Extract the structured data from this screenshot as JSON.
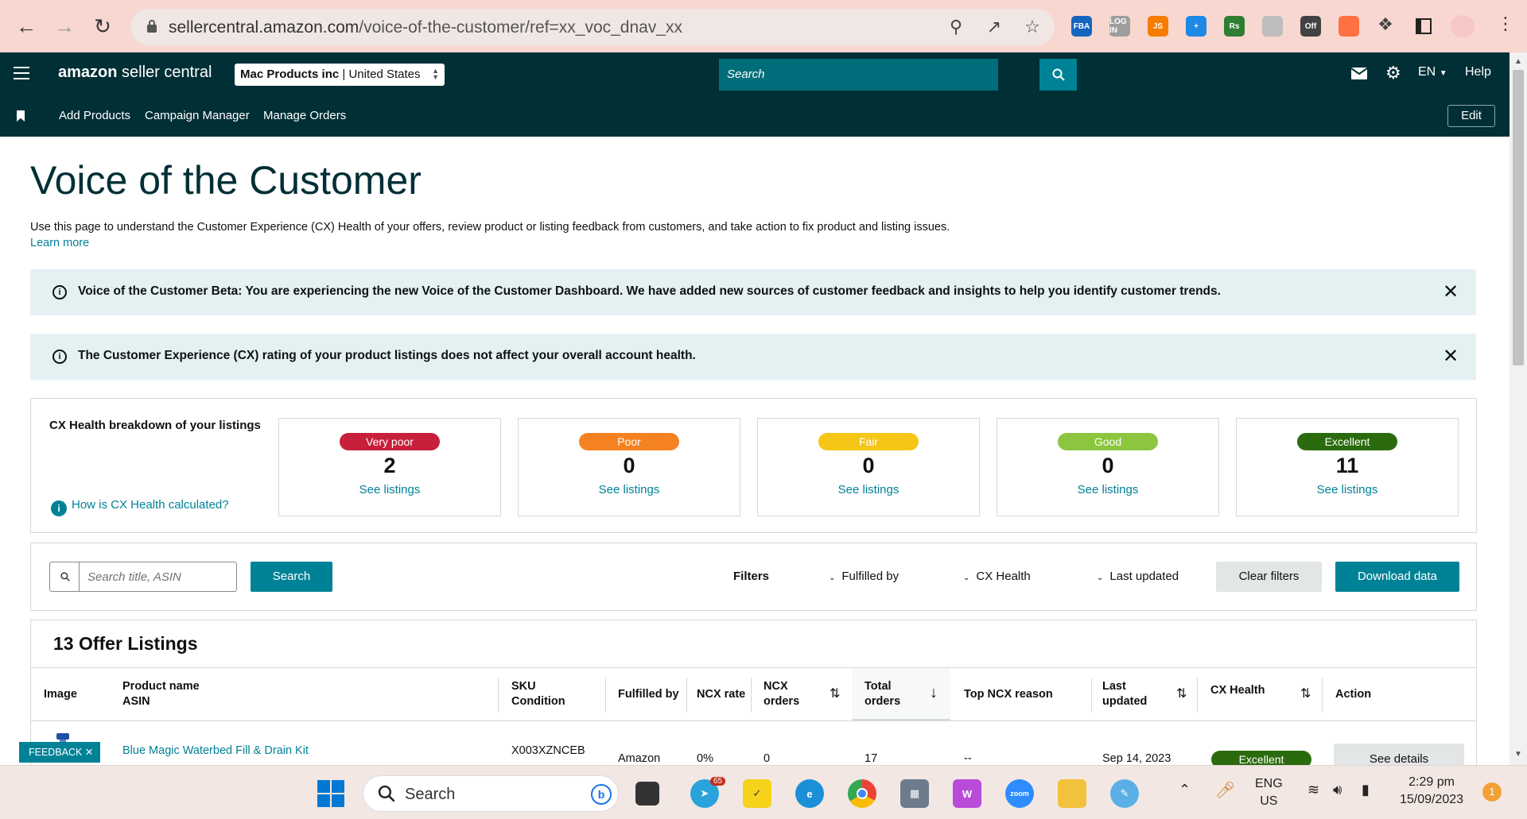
{
  "browser": {
    "url_host": "sellercentral.amazon.com",
    "url_path": "/voice-of-the-customer/ref=xx_voc_dnav_xx",
    "extensions": [
      {
        "name": "fba-extension-icon",
        "label": "FBA",
        "color": "#1565c0"
      },
      {
        "name": "login-extension-icon",
        "label": "LOG IN",
        "color": "#9e9e9e"
      },
      {
        "name": "js-extension-icon",
        "label": "JS",
        "color": "#f57c00"
      },
      {
        "name": "plus-extension-icon",
        "label": "+",
        "color": "#1e88e5"
      },
      {
        "name": "rs-extension-icon",
        "label": "Rs",
        "color": "#2e7d32"
      },
      {
        "name": "camera-extension-icon",
        "label": "",
        "color": "#bdbdbd"
      },
      {
        "name": "off-extension-icon",
        "label": "Off",
        "color": "#424242"
      },
      {
        "name": "orange-extension-icon",
        "label": "",
        "color": "#ff7043"
      }
    ]
  },
  "header": {
    "logo_bold": "amazon",
    "logo_rest": " seller central",
    "account_name": "Mac Products inc",
    "account_region": "United States",
    "search_placeholder": "Search",
    "language": "EN",
    "help": "Help"
  },
  "subnav": {
    "links": [
      "Add Products",
      "Campaign Manager",
      "Manage Orders"
    ],
    "edit": "Edit"
  },
  "page": {
    "title": "Voice of the Customer",
    "intro": "Use this page to understand the Customer Experience (CX) Health of your offers, review product or listing feedback from customers, and take action to fix product and listing issues.",
    "learn_more": "Learn more"
  },
  "banners": [
    {
      "text": "Voice of the Customer Beta: You are experiencing the new Voice of the Customer Dashboard. We have added new sources of customer feedback and insights to help you identify customer trends."
    },
    {
      "text": "The Customer Experience (CX) rating of your product listings does not affect your overall account health."
    }
  ],
  "cx_health": {
    "title": "CX Health breakdown of your listings",
    "help_link": "How is CX Health calculated?",
    "cards": [
      {
        "label": "Very poor",
        "count": "2",
        "link": "See listings",
        "color": "#c7203b"
      },
      {
        "label": "Poor",
        "count": "0",
        "link": "See listings",
        "color": "#f58220"
      },
      {
        "label": "Fair",
        "count": "0",
        "link": "See listings",
        "color": "#f5c518"
      },
      {
        "label": "Good",
        "count": "0",
        "link": "See listings",
        "color": "#8cc63f"
      },
      {
        "label": "Excellent",
        "count": "11",
        "link": "See listings",
        "color": "#2b6b0d"
      }
    ]
  },
  "filters": {
    "search_placeholder": "Search title, ASIN",
    "search_button": "Search",
    "label": "Filters",
    "dropdowns": [
      "Fulfilled by",
      "CX Health",
      "Last updated"
    ],
    "clear": "Clear filters",
    "download": "Download data"
  },
  "listings": {
    "title": "13 Offer Listings",
    "columns": {
      "image": "Image",
      "product_name": "Product name",
      "asin": "ASIN",
      "sku": "SKU",
      "condition": "Condition",
      "fulfilled_by": "Fulfilled by",
      "ncx_rate": "NCX rate",
      "ncx_orders_1": "NCX",
      "ncx_orders_2": "orders",
      "total_orders_1": "Total",
      "total_orders_2": "orders",
      "top_ncx_reason": "Top NCX reason",
      "last_updated_1": "Last",
      "last_updated_2": "updated",
      "cx_health": "CX Health",
      "action": "Action"
    },
    "rows": [
      {
        "product_name": "Blue Magic Waterbed Fill & Drain Kit",
        "sku": "X003XZNCEB",
        "fulfilled_by": "Amazon",
        "ncx_rate": "0%",
        "ncx_orders": "0",
        "total_orders": "17",
        "top_ncx_reason": "--",
        "last_updated": "Sep 14, 2023",
        "cx_health": "Excellent",
        "action": "See details"
      }
    ]
  },
  "feedback": "FEEDBACK ✕",
  "taskbar": {
    "search": "Search",
    "telegram_badge": "65",
    "lang_1": "ENG",
    "lang_2": "US",
    "time": "2:29 pm",
    "date": "15/09/2023",
    "notifications": "1"
  }
}
